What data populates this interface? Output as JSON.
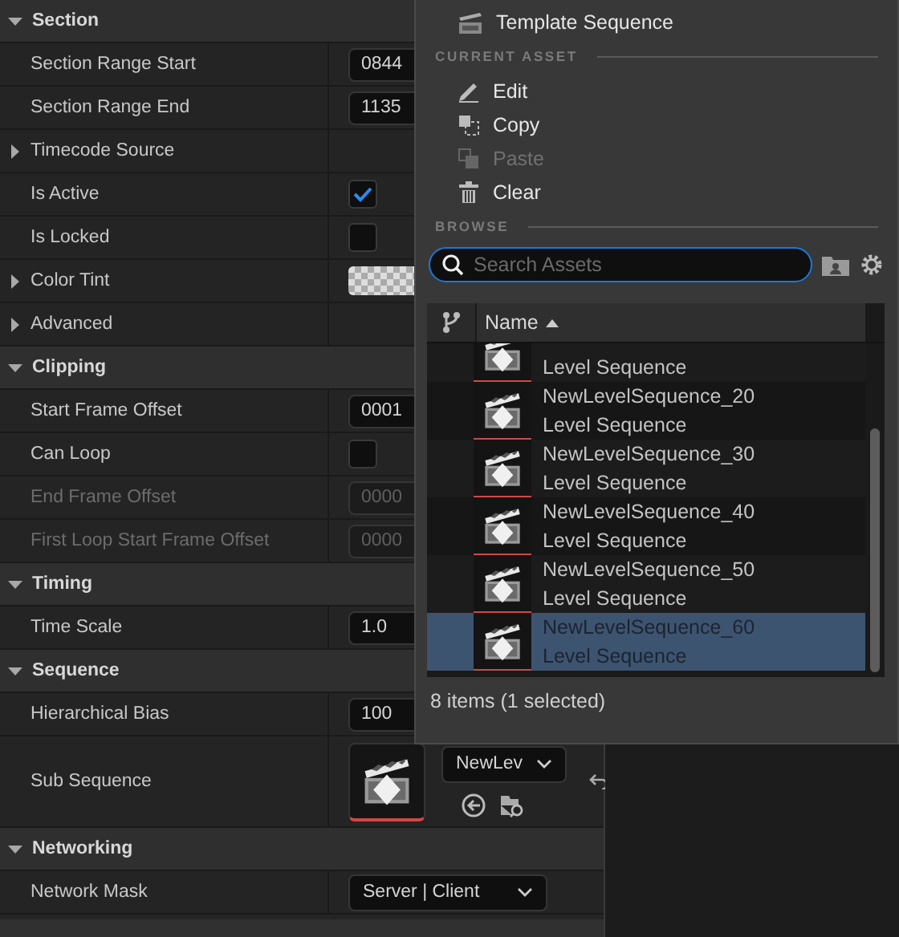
{
  "details": {
    "sections": [
      {
        "title": "Section",
        "expanded": true,
        "rows": [
          {
            "kind": "number",
            "label": "Section Range Start",
            "value": "0844",
            "disabled": false
          },
          {
            "kind": "number",
            "label": "Section Range End",
            "value": "1135",
            "disabled": false
          },
          {
            "kind": "group",
            "label": "Timecode Source",
            "expanded": false
          },
          {
            "kind": "checkbox",
            "label": "Is Active",
            "checked": true
          },
          {
            "kind": "checkbox",
            "label": "Is Locked",
            "checked": false
          },
          {
            "kind": "color",
            "label": "Color Tint",
            "expanded": false
          },
          {
            "kind": "group",
            "label": "Advanced",
            "expanded": false
          }
        ]
      },
      {
        "title": "Clipping",
        "expanded": true,
        "rows": [
          {
            "kind": "number",
            "label": "Start Frame Offset",
            "value": "0001",
            "disabled": false
          },
          {
            "kind": "checkbox",
            "label": "Can Loop",
            "checked": false
          },
          {
            "kind": "number",
            "label": "End Frame Offset",
            "value": "0000",
            "disabled": true
          },
          {
            "kind": "number",
            "label": "First Loop Start Frame Offset",
            "value": "0000",
            "disabled": true
          }
        ]
      },
      {
        "title": "Timing",
        "expanded": true,
        "rows": [
          {
            "kind": "number",
            "label": "Time Scale",
            "value": "1.0",
            "disabled": false
          }
        ]
      },
      {
        "title": "Sequence",
        "expanded": true,
        "rows": [
          {
            "kind": "number",
            "label": "Hierarchical Bias",
            "value": "100",
            "disabled": false
          },
          {
            "kind": "asset",
            "label": "Sub Sequence",
            "value": "NewLev"
          }
        ]
      },
      {
        "title": "Networking",
        "expanded": true,
        "rows": [
          {
            "kind": "dropdown",
            "label": "Network Mask",
            "value": "Server | Client"
          }
        ]
      }
    ]
  },
  "asset_menu": {
    "top_item": {
      "label": "Template Sequence"
    },
    "current_asset": {
      "title": "CURRENT ASSET",
      "items": [
        {
          "kind": "edit",
          "label": "Edit",
          "disabled": false
        },
        {
          "kind": "copy",
          "label": "Copy",
          "disabled": false
        },
        {
          "kind": "paste",
          "label": "Paste",
          "disabled": true
        },
        {
          "kind": "clear",
          "label": "Clear",
          "disabled": false
        }
      ]
    },
    "browse": {
      "title": "BROWSE",
      "search": {
        "placeholder": "Search Assets"
      },
      "column": {
        "label": "Name",
        "sorted": true
      },
      "items": [
        {
          "type": "Level Sequence",
          "selected": false
        },
        {
          "name": "NewLevelSequence_20",
          "type": "Level Sequence",
          "selected": false
        },
        {
          "name": "NewLevelSequence_30",
          "type": "Level Sequence",
          "selected": false
        },
        {
          "name": "NewLevelSequence_40",
          "type": "Level Sequence",
          "selected": false
        },
        {
          "name": "NewLevelSequence_50",
          "type": "Level Sequence",
          "selected": false
        },
        {
          "name": "NewLevelSequence_60",
          "type": "Level Sequence",
          "selected": true
        }
      ],
      "status": "8 items (1 selected)"
    }
  }
}
